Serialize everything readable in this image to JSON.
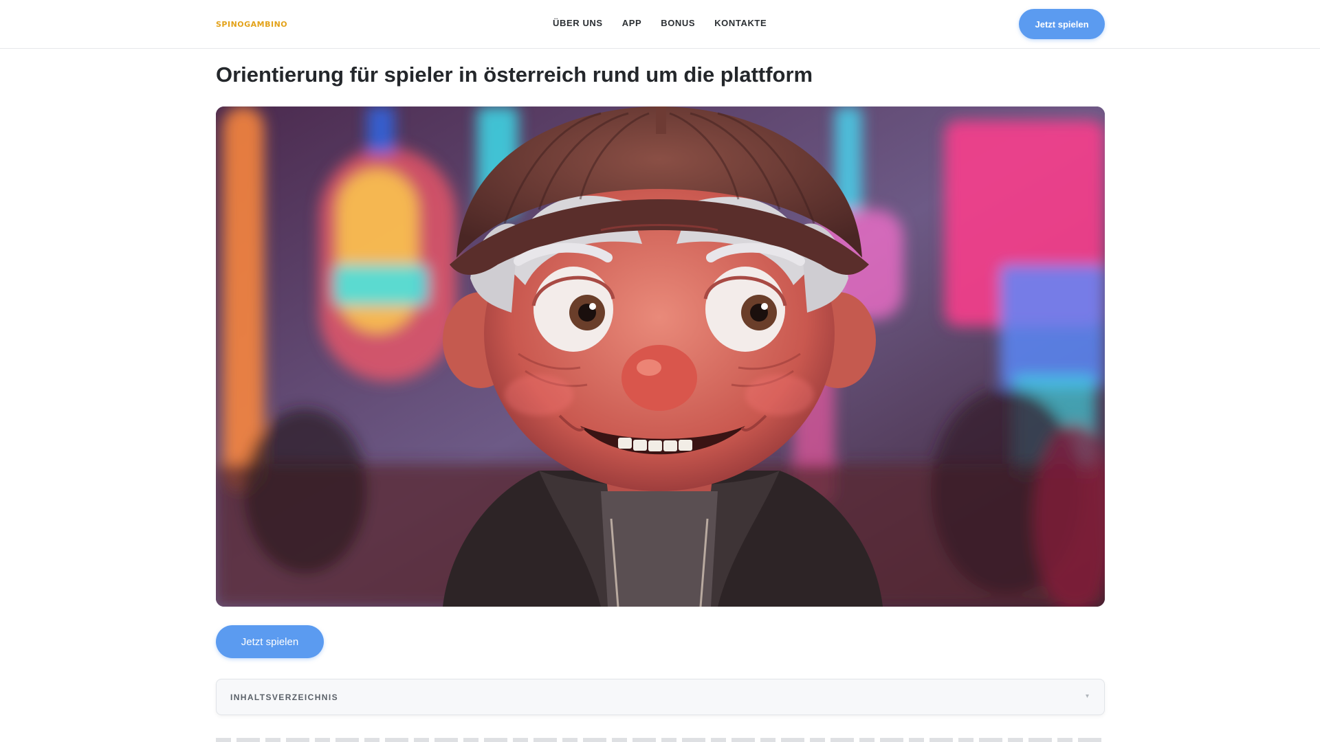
{
  "header": {
    "logo_text": "SPINOGAMBINO",
    "nav": [
      {
        "label": "ÜBER UNS"
      },
      {
        "label": "APP"
      },
      {
        "label": "BONUS"
      },
      {
        "label": "KONTAKTE"
      }
    ],
    "cta_label": "Jetzt spielen"
  },
  "main": {
    "title": "Orientierung für spieler in österreich rund um die plattform",
    "hero_icon": "cartoon-old-man-casino-image",
    "cta_label": "Jetzt spielen",
    "toc": {
      "title": "INHALTSVERZEICHNIS",
      "toggle_icon": "chevron-down-icon"
    }
  },
  "colors": {
    "accent": "#5b9bf0",
    "logo": "#e3a21a"
  }
}
